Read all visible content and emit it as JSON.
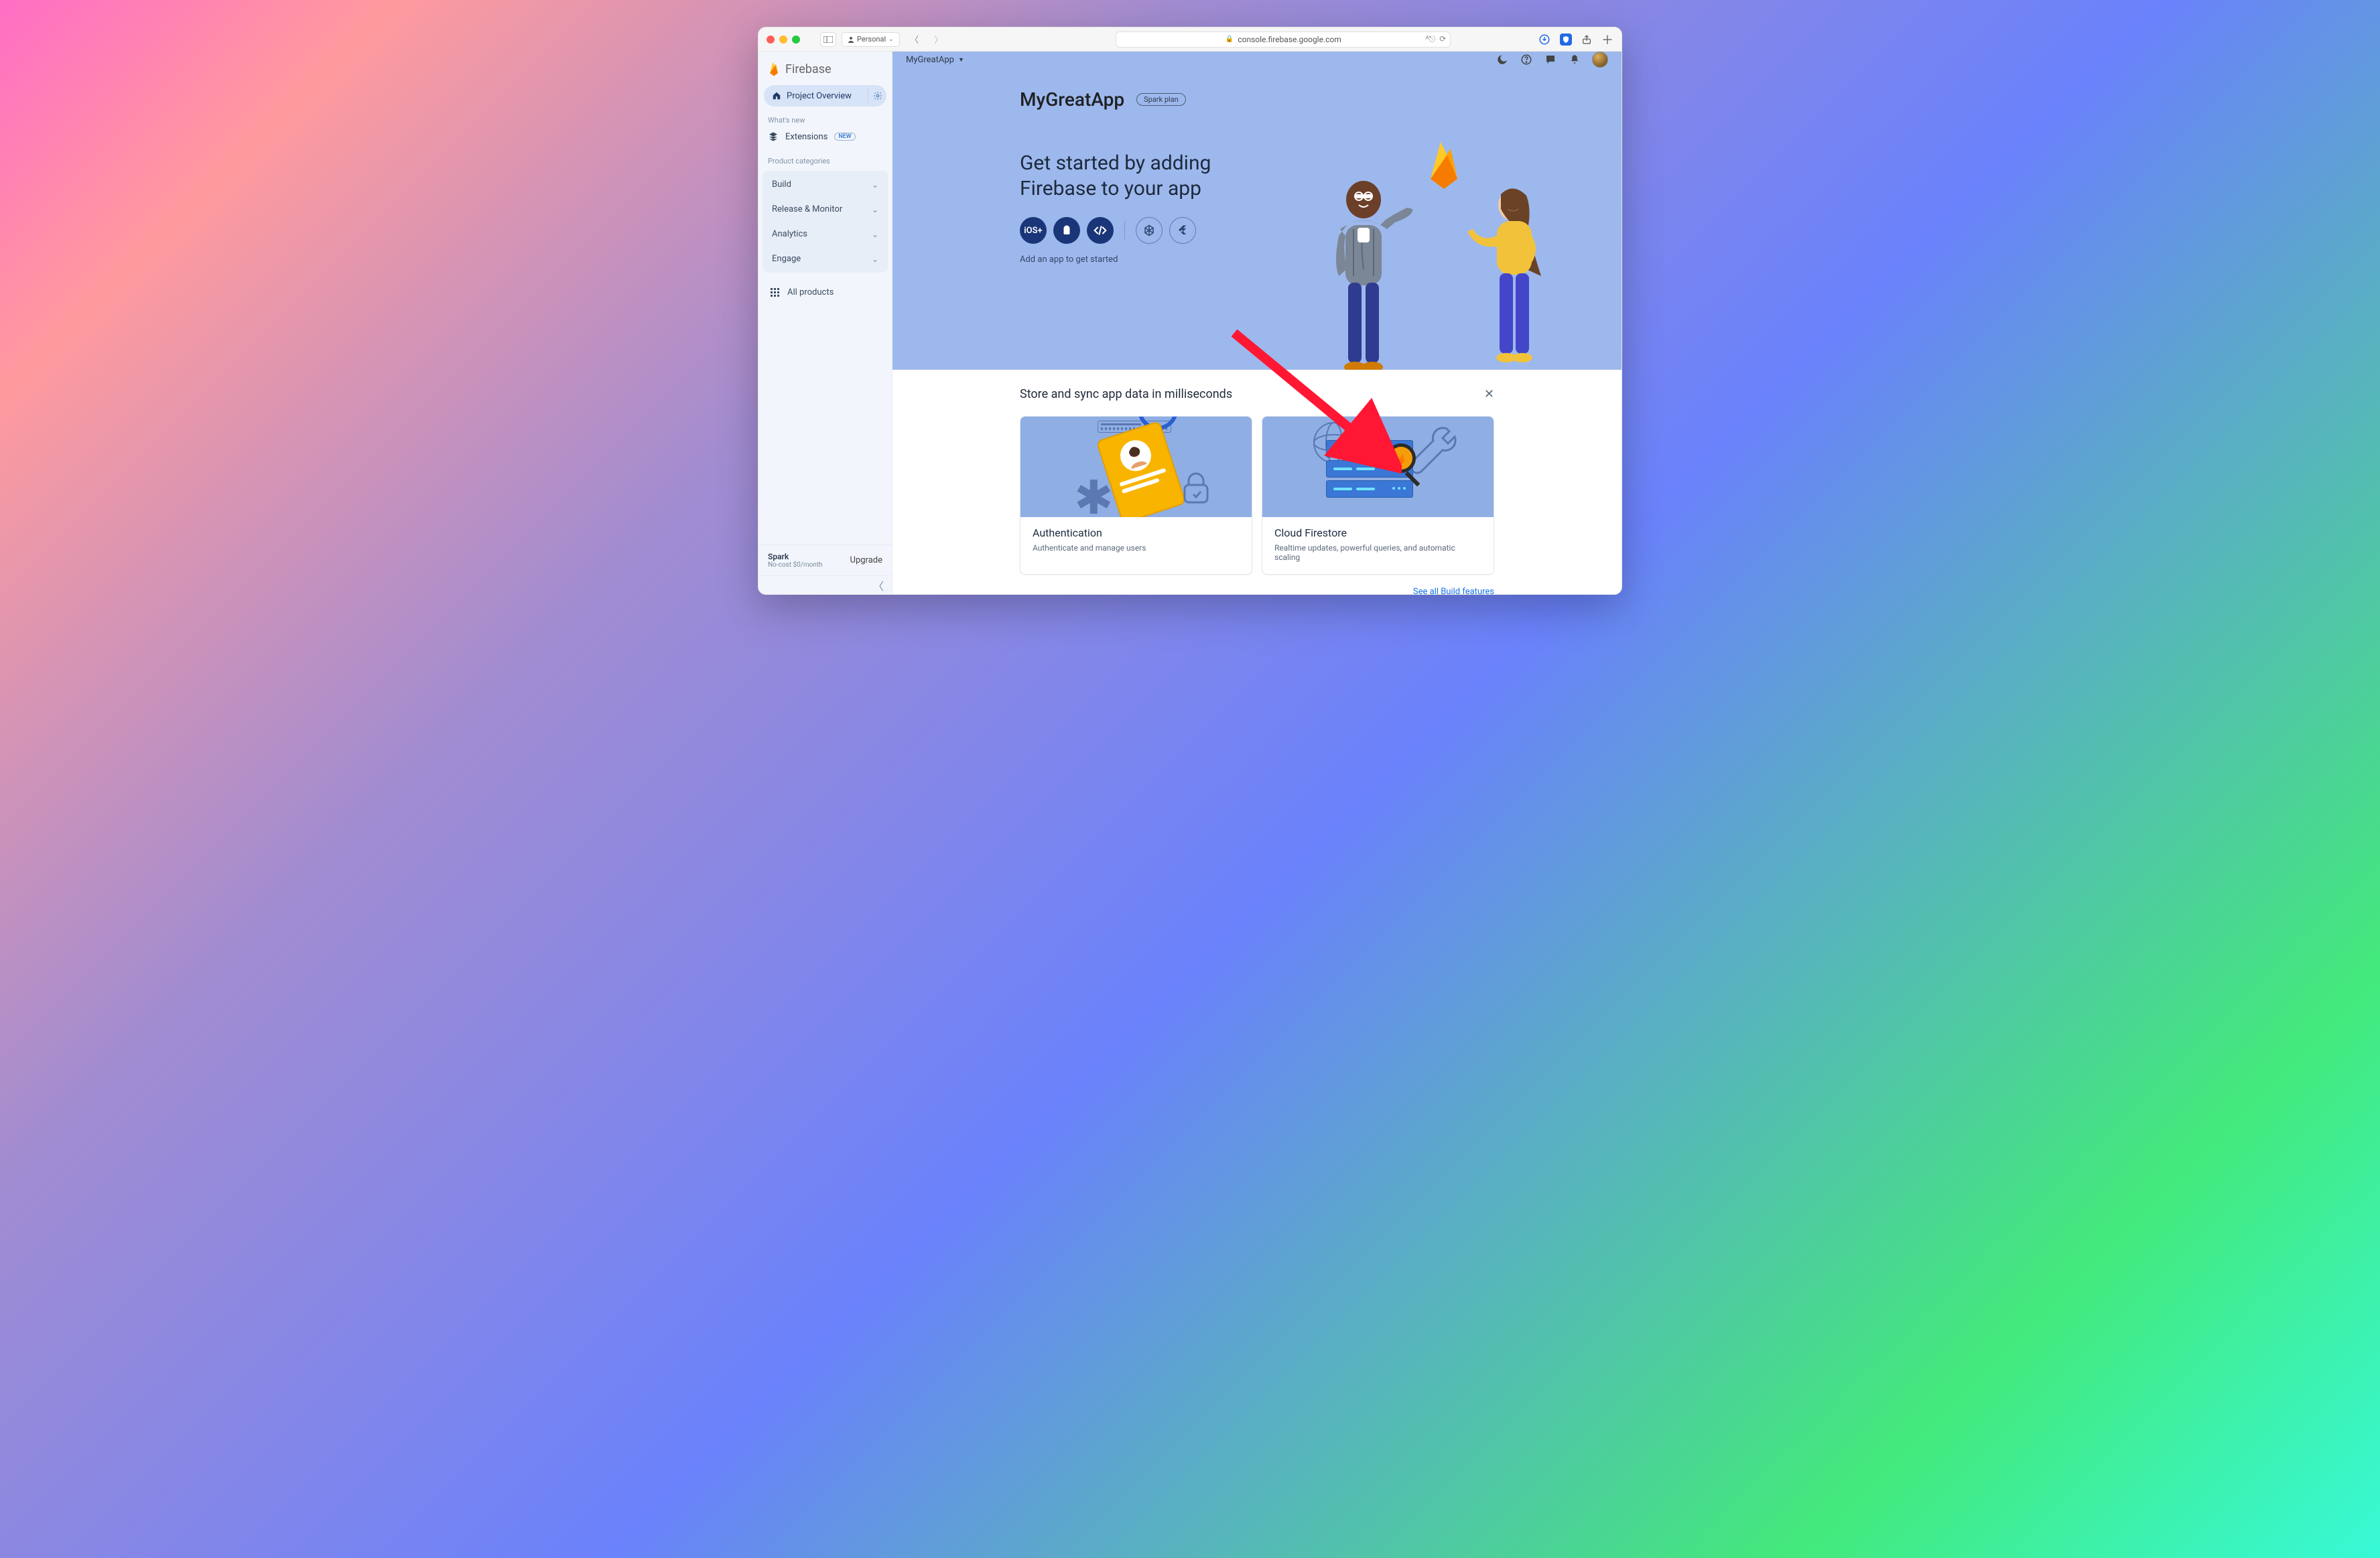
{
  "browser": {
    "profile_label": "Personal",
    "url": "console.firebase.google.com"
  },
  "brand": {
    "name": "Firebase"
  },
  "sidebar": {
    "project_overview": "Project Overview",
    "whats_new_label": "What's new",
    "extensions_label": "Extensions",
    "extensions_badge": "NEW",
    "product_categories_label": "Product categories",
    "categories": [
      {
        "label": "Build"
      },
      {
        "label": "Release & Monitor"
      },
      {
        "label": "Analytics"
      },
      {
        "label": "Engage"
      }
    ],
    "all_products": "All products",
    "footer_plan": "Spark",
    "footer_sub": "No-cost $0/month",
    "upgrade": "Upgrade"
  },
  "breadcrumb": {
    "project": "MyGreatApp"
  },
  "hero": {
    "title": "MyGreatApp",
    "plan_pill": "Spark plan",
    "headline": "Get started by adding Firebase to your app",
    "apps": [
      {
        "label": "iOS+",
        "name": "ios"
      },
      {
        "label": "android",
        "name": "android"
      },
      {
        "label": "web",
        "name": "web"
      },
      {
        "label": "unity",
        "name": "unity"
      },
      {
        "label": "flutter",
        "name": "flutter"
      }
    ],
    "hint": "Add an app to get started"
  },
  "promo": {
    "heading": "Store and sync app data in milliseconds",
    "cards": [
      {
        "title": "Authentication",
        "desc": "Authenticate and manage users"
      },
      {
        "title": "Cloud Firestore",
        "desc": "Realtime updates, powerful queries, and automatic scaling"
      }
    ],
    "see_all": "See all Build features"
  }
}
